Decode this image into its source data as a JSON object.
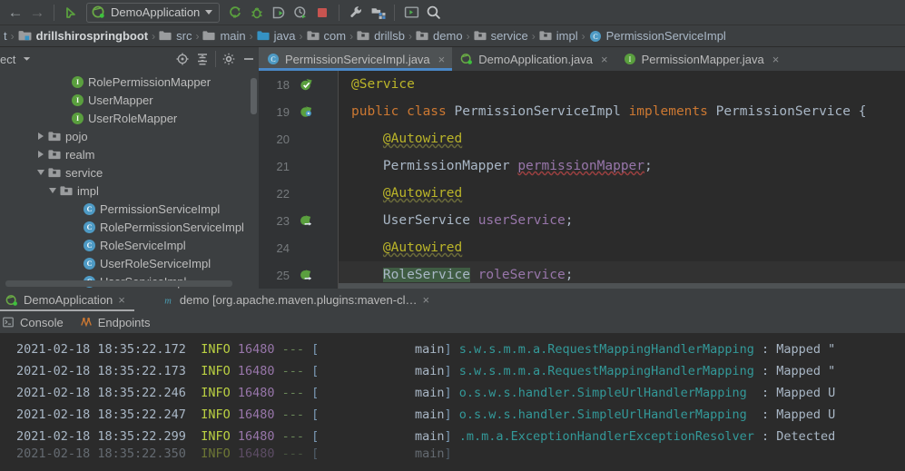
{
  "toolbar": {
    "back_icon": "arrow-left-icon",
    "forward_icon": "arrow-right-icon",
    "pointer_icon": "cursor-arrow-icon",
    "run_config_name": "DemoApplication",
    "run_icon": "run-icon",
    "debug_icon": "debug-bug-icon",
    "run_coverage_icon": "run-with-coverage-icon",
    "profile_icon": "profiler-icon",
    "stop_icon": "stop-square-icon",
    "settings_icon": "wrench-icon",
    "project-structure_icon": "project-structure-icon",
    "terminal_icon": "terminal-icon",
    "search_icon": "search-everywhere-icon",
    "accent_blue": "#4a88c7",
    "run_green": "#5a9f3e",
    "stop_red": "#c75450"
  },
  "breadcrumb": {
    "leading_fragment": "t",
    "items": [
      {
        "label": "drillshirospringboot",
        "icon": "module-icon",
        "bold": true
      },
      {
        "label": "src",
        "icon": "folder-icon",
        "bold": false
      },
      {
        "label": "main",
        "icon": "folder-icon",
        "bold": false
      },
      {
        "label": "java",
        "icon": "source-folder-icon",
        "bold": false
      },
      {
        "label": "com",
        "icon": "package-icon",
        "bold": false
      },
      {
        "label": "drillsb",
        "icon": "package-icon",
        "bold": false
      },
      {
        "label": "demo",
        "icon": "package-icon",
        "bold": false
      },
      {
        "label": "service",
        "icon": "package-icon",
        "bold": false
      },
      {
        "label": "impl",
        "icon": "package-icon",
        "bold": false
      },
      {
        "label": "PermissionServiceImpl",
        "icon": "class-icon",
        "bold": false
      }
    ],
    "separator": "›"
  },
  "project_panel": {
    "title": "ect",
    "title_caret_icon": "chevron-down-icon",
    "locate_icon": "select-opened-file-icon",
    "collapse_icon": "collapse-all-icon",
    "settings_icon": "gear-icon",
    "hide_icon": "minimize-icon",
    "tree": [
      {
        "label": "RolePermissionMapper",
        "indent": 5,
        "twisty": "none",
        "kind": "interface"
      },
      {
        "label": "UserMapper",
        "indent": 5,
        "twisty": "none",
        "kind": "interface"
      },
      {
        "label": "UserRoleMapper",
        "indent": 5,
        "twisty": "none",
        "kind": "interface"
      },
      {
        "label": "pojo",
        "indent": 3,
        "twisty": "right",
        "kind": "package"
      },
      {
        "label": "realm",
        "indent": 3,
        "twisty": "right",
        "kind": "package"
      },
      {
        "label": "service",
        "indent": 3,
        "twisty": "down",
        "kind": "package"
      },
      {
        "label": "impl",
        "indent": 4,
        "twisty": "down",
        "kind": "package"
      },
      {
        "label": "PermissionServiceImpl",
        "indent": 6,
        "twisty": "none",
        "kind": "class"
      },
      {
        "label": "RolePermissionServiceImpl",
        "indent": 6,
        "twisty": "none",
        "kind": "class"
      },
      {
        "label": "RoleServiceImpl",
        "indent": 6,
        "twisty": "none",
        "kind": "class"
      },
      {
        "label": "UserRoleServiceImpl",
        "indent": 6,
        "twisty": "none",
        "kind": "class"
      },
      {
        "label": "UserServiceImpl",
        "indent": 6,
        "twisty": "none",
        "kind": "class"
      }
    ]
  },
  "editor": {
    "tabs": [
      {
        "label": "PermissionServiceImpl.java",
        "icon": "class-icon",
        "active": true,
        "close": "×"
      },
      {
        "label": "DemoApplication.java",
        "icon": "spring-boot-icon",
        "active": false,
        "close": "×"
      },
      {
        "label": "PermissionMapper.java",
        "icon": "interface-icon",
        "active": false,
        "close": "×"
      }
    ],
    "lines": [
      {
        "num": "18",
        "gutter": "bean-checked-icon",
        "current": false,
        "tokens": [
          {
            "t": "ann",
            "v": "@Service"
          }
        ]
      },
      {
        "num": "19",
        "gutter": "spring-bean-icon",
        "current": false,
        "tokens": [
          {
            "t": "kw",
            "v": "public "
          },
          {
            "t": "kw",
            "v": "class "
          },
          {
            "t": "type",
            "v": "PermissionServiceImpl "
          },
          {
            "t": "kw",
            "v": "implements "
          },
          {
            "t": "type",
            "v": "PermissionService "
          },
          {
            "t": "plain",
            "v": "{"
          }
        ]
      },
      {
        "num": "20",
        "gutter": "",
        "current": false,
        "tokens": [
          {
            "t": "indent",
            "v": "    "
          },
          {
            "t": "ann-sq",
            "v": "@Autowired"
          }
        ]
      },
      {
        "num": "21",
        "gutter": "",
        "current": false,
        "tokens": [
          {
            "t": "indent",
            "v": "    "
          },
          {
            "t": "type",
            "v": "PermissionMapper "
          },
          {
            "t": "field-sqr",
            "v": "permissionMapper"
          },
          {
            "t": "plain",
            "v": ";"
          }
        ]
      },
      {
        "num": "22",
        "gutter": "",
        "current": false,
        "tokens": [
          {
            "t": "indent",
            "v": "    "
          },
          {
            "t": "ann-sq",
            "v": "@Autowired"
          }
        ]
      },
      {
        "num": "23",
        "gutter": "implemented-icon",
        "current": false,
        "tokens": [
          {
            "t": "indent",
            "v": "    "
          },
          {
            "t": "type",
            "v": "UserService "
          },
          {
            "t": "field",
            "v": "userService"
          },
          {
            "t": "plain",
            "v": ";"
          }
        ]
      },
      {
        "num": "24",
        "gutter": "",
        "current": false,
        "tokens": [
          {
            "t": "indent",
            "v": "    "
          },
          {
            "t": "ann-sq",
            "v": "@Autowired"
          }
        ]
      },
      {
        "num": "25",
        "gutter": "implemented-icon",
        "current": true,
        "tokens": [
          {
            "t": "indent",
            "v": "    "
          },
          {
            "t": "type-sel",
            "v": "RoleService"
          },
          {
            "t": "type",
            "v": " "
          },
          {
            "t": "field",
            "v": "roleService"
          },
          {
            "t": "plain",
            "v": ";"
          }
        ]
      }
    ]
  },
  "run_panel": {
    "tabs": [
      {
        "label": "DemoApplication",
        "icon": "spring-boot-icon",
        "active": true,
        "close": "×"
      },
      {
        "label": "demo [org.apache.maven.plugins:maven-cl…",
        "icon": "maven-icon",
        "active": false,
        "close": "×"
      }
    ],
    "sub_tabs": [
      {
        "label": "Console",
        "icon": "console-icon"
      },
      {
        "label": "Endpoints",
        "icon": "endpoints-icon"
      }
    ],
    "console_lines": [
      {
        "date": "2021-02-18 18:35:22.172",
        "level": "INFO",
        "pid": "16480",
        "dashes": "---",
        "thread": "main",
        "logger": "s.w.s.m.m.a.RequestMappingHandlerMapping",
        "msg": "Mapped \""
      },
      {
        "date": "2021-02-18 18:35:22.173",
        "level": "INFO",
        "pid": "16480",
        "dashes": "---",
        "thread": "main",
        "logger": "s.w.s.m.m.a.RequestMappingHandlerMapping",
        "msg": "Mapped \""
      },
      {
        "date": "2021-02-18 18:35:22.246",
        "level": "INFO",
        "pid": "16480",
        "dashes": "---",
        "thread": "main",
        "logger": "o.s.w.s.handler.SimpleUrlHandlerMapping ",
        "msg": "Mapped U"
      },
      {
        "date": "2021-02-18 18:35:22.247",
        "level": "INFO",
        "pid": "16480",
        "dashes": "---",
        "thread": "main",
        "logger": "o.s.w.s.handler.SimpleUrlHandlerMapping ",
        "msg": "Mapped U"
      },
      {
        "date": "2021-02-18 18:35:22.299",
        "level": "INFO",
        "pid": "16480",
        "dashes": "---",
        "thread": "main",
        "logger": ".m.m.a.ExceptionHandlerExceptionResolver",
        "msg": "Detected"
      },
      {
        "date": "2021-02-18 18:35:22.350",
        "level": "INFO",
        "pid": "16480",
        "dashes": "---",
        "thread": "main",
        "logger": "",
        "msg": ""
      }
    ]
  }
}
